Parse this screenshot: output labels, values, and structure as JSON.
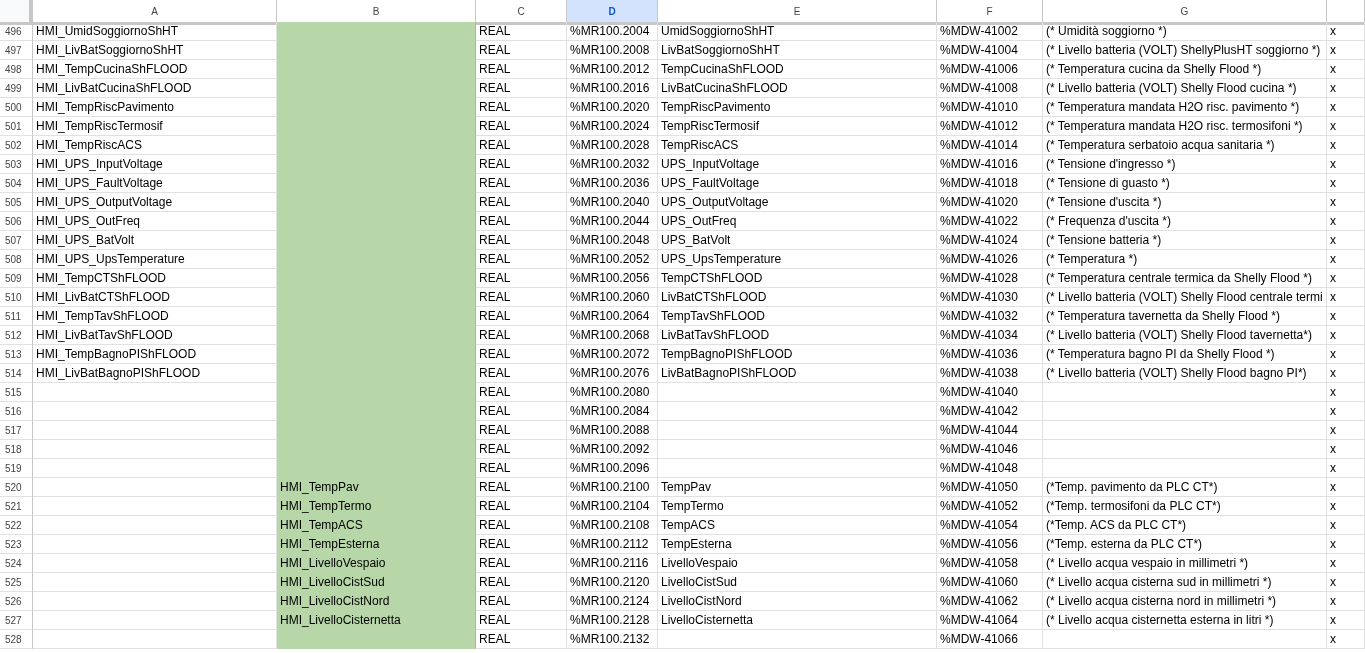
{
  "columns": [
    {
      "letter": "A",
      "selected": false
    },
    {
      "letter": "B",
      "selected": false,
      "color": "#b7d7a8"
    },
    {
      "letter": "C",
      "selected": false
    },
    {
      "letter": "D",
      "selected": true
    },
    {
      "letter": "E",
      "selected": false
    },
    {
      "letter": "F",
      "selected": false
    },
    {
      "letter": "G",
      "selected": false
    },
    {
      "selected": false
    }
  ],
  "rows": [
    {
      "row": "496",
      "cells": {
        "A": "HMI_UmidSoggiornoShHT",
        "C": "REAL",
        "D": "%MR100.2004",
        "E": "UmidSoggiornoShHT",
        "F": "%MDW-41002",
        "G": "(* Umidità soggiorno *)",
        "H": "x"
      }
    },
    {
      "row": "497",
      "cells": {
        "A": "HMI_LivBatSoggiornoShHT",
        "C": "REAL",
        "D": "%MR100.2008",
        "E": "LivBatSoggiornoShHT",
        "F": "%MDW-41004",
        "G": "(* Livello batteria (VOLT) ShellyPlusHT soggiorno *)",
        "H": "x"
      }
    },
    {
      "row": "498",
      "cells": {
        "A": "HMI_TempCucinaShFLOOD",
        "C": "REAL",
        "D": "%MR100.2012",
        "E": "TempCucinaShFLOOD",
        "F": "%MDW-41006",
        "G": "(* Temperatura cucina da Shelly Flood *)",
        "H": "x"
      }
    },
    {
      "row": "499",
      "cells": {
        "A": "HMI_LivBatCucinaShFLOOD",
        "C": "REAL",
        "D": "%MR100.2016",
        "E": "LivBatCucinaShFLOOD",
        "F": "%MDW-41008",
        "G": "(* Livello batteria (VOLT) Shelly Flood cucina *)",
        "H": "x"
      }
    },
    {
      "row": "500",
      "cells": {
        "A": "HMI_TempRiscPavimento",
        "C": "REAL",
        "D": "%MR100.2020",
        "E": "TempRiscPavimento",
        "F": "%MDW-41010",
        "G": "(* Temperatura mandata H2O risc. pavimento *)",
        "H": "x"
      }
    },
    {
      "row": "501",
      "cells": {
        "A": "HMI_TempRiscTermosif",
        "C": "REAL",
        "D": "%MR100.2024",
        "E": "TempRiscTermosif",
        "F": "%MDW-41012",
        "G": "(* Temperatura mandata H2O risc. termosifoni *)",
        "H": "x"
      }
    },
    {
      "row": "502",
      "cells": {
        "A": "HMI_TempRiscACS",
        "C": "REAL",
        "D": "%MR100.2028",
        "E": "TempRiscACS",
        "F": "%MDW-41014",
        "G": "(* Temperatura serbatoio acqua sanitaria *)",
        "H": "x"
      }
    },
    {
      "row": "503",
      "cells": {
        "A": "HMI_UPS_InputVoltage",
        "C": "REAL",
        "D": "%MR100.2032",
        "E": "UPS_InputVoltage",
        "F": "%MDW-41016",
        "G": "(* Tensione d'ingresso *)",
        "H": "x"
      }
    },
    {
      "row": "504",
      "cells": {
        "A": "HMI_UPS_FaultVoltage",
        "C": "REAL",
        "D": "%MR100.2036",
        "E": "UPS_FaultVoltage",
        "F": "%MDW-41018",
        "G": "(* Tensione di guasto *)",
        "H": "x"
      }
    },
    {
      "row": "505",
      "cells": {
        "A": "HMI_UPS_OutputVoltage",
        "C": "REAL",
        "D": "%MR100.2040",
        "E": "UPS_OutputVoltage",
        "F": "%MDW-41020",
        "G": "(* Tensione d'uscita *)",
        "H": "x"
      }
    },
    {
      "row": "506",
      "cells": {
        "A": "HMI_UPS_OutFreq",
        "C": "REAL",
        "D": "%MR100.2044",
        "E": "UPS_OutFreq",
        "F": "%MDW-41022",
        "G": "(* Frequenza d'uscita *)",
        "H": "x"
      }
    },
    {
      "row": "507",
      "cells": {
        "A": "HMI_UPS_BatVolt",
        "C": "REAL",
        "D": "%MR100.2048",
        "E": "UPS_BatVolt",
        "F": "%MDW-41024",
        "G": "(* Tensione batteria *)",
        "H": "x"
      }
    },
    {
      "row": "508",
      "cells": {
        "A": "HMI_UPS_UpsTemperature",
        "C": "REAL",
        "D": "%MR100.2052",
        "E": "UPS_UpsTemperature",
        "F": "%MDW-41026",
        "G": "(* Temperatura *)",
        "H": "x"
      }
    },
    {
      "row": "509",
      "cells": {
        "A": "HMI_TempCTShFLOOD",
        "C": "REAL",
        "D": "%MR100.2056",
        "E": "TempCTShFLOOD",
        "F": "%MDW-41028",
        "G": "(* Temperatura centrale termica da Shelly Flood *)",
        "H": "x"
      }
    },
    {
      "row": "510",
      "cells": {
        "A": "HMI_LivBatCTShFLOOD",
        "C": "REAL",
        "D": "%MR100.2060",
        "E": "LivBatCTShFLOOD",
        "F": "%MDW-41030",
        "G": "(* Livello batteria (VOLT) Shelly Flood centrale termi",
        "H": "x"
      }
    },
    {
      "row": "511",
      "cells": {
        "A": "HMI_TempTavShFLOOD",
        "C": "REAL",
        "D": "%MR100.2064",
        "E": "TempTavShFLOOD",
        "F": "%MDW-41032",
        "G": "(* Temperatura tavernetta da Shelly Flood *)",
        "H": "x"
      }
    },
    {
      "row": "512",
      "cells": {
        "A": "HMI_LivBatTavShFLOOD",
        "C": "REAL",
        "D": "%MR100.2068",
        "E": "LivBatTavShFLOOD",
        "F": "%MDW-41034",
        "G": "(* Livello batteria (VOLT) Shelly Flood tavernetta*)",
        "H": "x"
      }
    },
    {
      "row": "513",
      "cells": {
        "A": "HMI_TempBagnoPIShFLOOD",
        "C": "REAL",
        "D": "%MR100.2072",
        "E": "TempBagnoPIShFLOOD",
        "F": "%MDW-41036",
        "G": "(* Temperatura bagno PI da Shelly Flood *)",
        "H": "x"
      }
    },
    {
      "row": "514",
      "cells": {
        "A": "HMI_LivBatBagnoPIShFLOOD",
        "C": "REAL",
        "D": "%MR100.2076",
        "E": "LivBatBagnoPIShFLOOD",
        "F": "%MDW-41038",
        "G": "(* Livello batteria (VOLT) Shelly Flood bagno PI*)",
        "H": "x"
      }
    },
    {
      "row": "515",
      "cells": {
        "C": "REAL",
        "D": "%MR100.2080",
        "F": "%MDW-41040",
        "H": "x"
      }
    },
    {
      "row": "516",
      "cells": {
        "C": "REAL",
        "D": "%MR100.2084",
        "F": "%MDW-41042",
        "H": "x"
      }
    },
    {
      "row": "517",
      "cells": {
        "C": "REAL",
        "D": "%MR100.2088",
        "F": "%MDW-41044",
        "H": "x"
      }
    },
    {
      "row": "518",
      "cells": {
        "C": "REAL",
        "D": "%MR100.2092",
        "F": "%MDW-41046",
        "H": "x"
      }
    },
    {
      "row": "519",
      "cells": {
        "C": "REAL",
        "D": "%MR100.2096",
        "F": "%MDW-41048",
        "H": "x"
      }
    },
    {
      "row": "520",
      "cells": {
        "B": "HMI_TempPav",
        "C": "REAL",
        "D": "%MR100.2100",
        "E": "TempPav",
        "F": "%MDW-41050",
        "G": "(*Temp. pavimento da PLC CT*)",
        "H": "x"
      }
    },
    {
      "row": "521",
      "cells": {
        "B": "HMI_TempTermo",
        "C": "REAL",
        "D": "%MR100.2104",
        "E": "TempTermo",
        "F": "%MDW-41052",
        "G": "(*Temp. termosifoni da PLC CT*)",
        "H": "x"
      }
    },
    {
      "row": "522",
      "cells": {
        "B": "HMI_TempACS",
        "C": "REAL",
        "D": "%MR100.2108",
        "E": "TempACS",
        "F": "%MDW-41054",
        "G": "(*Temp. ACS da PLC CT*)",
        "H": "x"
      }
    },
    {
      "row": "523",
      "cells": {
        "B": "HMI_TempEsterna",
        "C": "REAL",
        "D": "%MR100.2112",
        "E": "TempEsterna",
        "F": "%MDW-41056",
        "G": "(*Temp. esterna da PLC CT*)",
        "H": "x"
      }
    },
    {
      "row": "524",
      "cells": {
        "B": "HMI_LivelloVespaio",
        "C": "REAL",
        "D": "%MR100.2116",
        "E": "LivelloVespaio",
        "F": "%MDW-41058",
        "G": "(* Livello acqua vespaio in millimetri *)",
        "H": "x"
      }
    },
    {
      "row": "525",
      "cells": {
        "B": "HMI_LivelloCistSud",
        "C": "REAL",
        "D": "%MR100.2120",
        "E": "LivelloCistSud",
        "F": "%MDW-41060",
        "G": "(* Livello acqua cisterna sud in millimetri *)",
        "H": "x"
      }
    },
    {
      "row": "526",
      "cells": {
        "B": "HMI_LivelloCistNord",
        "C": "REAL",
        "D": "%MR100.2124",
        "E": "LivelloCistNord",
        "F": "%MDW-41062",
        "G": "(* Livello acqua cisterna nord in millimetri *)",
        "H": "x"
      }
    },
    {
      "row": "527",
      "cells": {
        "B": "HMI_LivelloCisternetta",
        "C": "REAL",
        "D": "%MR100.2128",
        "E": "LivelloCisternetta",
        "F": "%MDW-41064",
        "G": "(* Livello acqua cisternetta esterna in litri *)",
        "H": "x"
      }
    },
    {
      "row": "528",
      "cells": {
        "C": "REAL",
        "D": "%MR100.2132",
        "F": "%MDW-41066",
        "H": "x"
      }
    }
  ]
}
